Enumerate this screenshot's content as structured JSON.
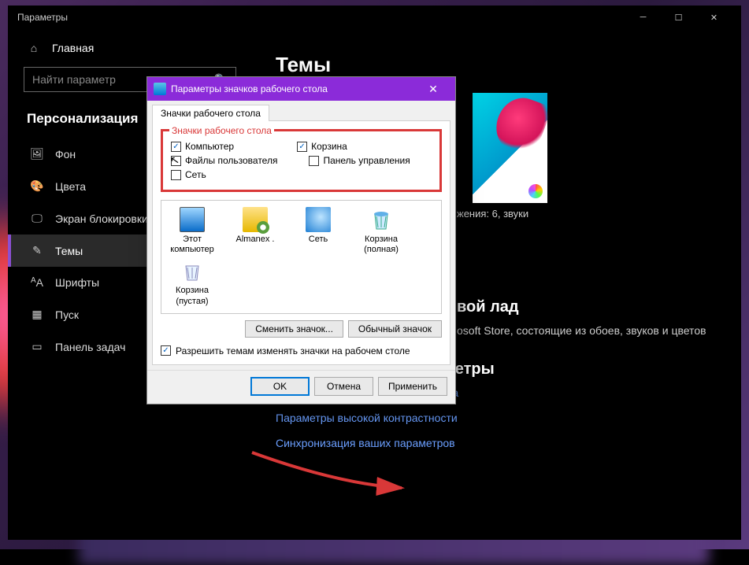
{
  "window": {
    "title": "Параметры",
    "minimize": "minimize",
    "maximize": "maximize",
    "close": "close"
  },
  "sidebar": {
    "home": "Главная",
    "search_placeholder": "Найти параметр",
    "section": "Персонализация",
    "items": [
      {
        "icon": "image-icon",
        "label": "Фон"
      },
      {
        "icon": "palette-icon",
        "label": "Цвета"
      },
      {
        "icon": "lock-icon",
        "label": "Экран блокировки"
      },
      {
        "icon": "theme-icon",
        "label": "Темы"
      },
      {
        "icon": "font-icon",
        "label": "Шрифты"
      },
      {
        "icon": "start-icon",
        "label": "Пуск"
      },
      {
        "icon": "taskbar-icon",
        "label": "Панель задач"
      }
    ],
    "active_index": 3
  },
  "main": {
    "title": "Темы",
    "theme_sub": "жения: 6, звуки",
    "section_heading": "вой лад",
    "section_desc": "osoft Store, состоящие из обоев, звуков и цветов",
    "related_heading": "Сопутствующие параметры",
    "links": [
      "Параметры значков рабочего стола",
      "Параметры высокой контрастности",
      "Синхронизация ваших параметров"
    ]
  },
  "dialog": {
    "title": "Параметры значков рабочего стола",
    "tab": "Значки рабочего стола",
    "fieldset_legend": "Значки рабочего стола",
    "checkboxes": {
      "computer": {
        "label": "Компьютер",
        "checked": true
      },
      "recycle": {
        "label": "Корзина",
        "checked": true
      },
      "userfiles": {
        "label": "Файлы пользователя",
        "checked": false
      },
      "controlpanel": {
        "label": "Панель управления",
        "checked": false
      },
      "network": {
        "label": "Сеть",
        "checked": false
      }
    },
    "icons": [
      {
        "name": "Этот компьютер",
        "kind": "computer"
      },
      {
        "name": "Almanex .",
        "kind": "folder"
      },
      {
        "name": "Сеть",
        "kind": "network"
      },
      {
        "name": "Корзина (полная)",
        "kind": "bin-full"
      },
      {
        "name": "Корзина (пустая)",
        "kind": "bin-empty"
      }
    ],
    "change_icon": "Сменить значок...",
    "default_icon": "Обычный значок",
    "allow_themes": "Разрешить темам изменять значки на рабочем столе",
    "ok": "OK",
    "cancel": "Отмена",
    "apply": "Применить"
  }
}
